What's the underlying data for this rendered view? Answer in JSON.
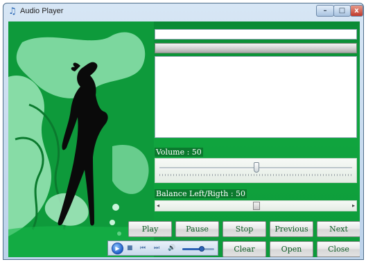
{
  "window": {
    "title": "Audio Player",
    "app_icon": "music-note-icon",
    "controls": {
      "minimize": "minimize-icon",
      "maximize": "maximize-icon",
      "close": "close-icon"
    }
  },
  "track": {
    "title": ""
  },
  "progress": {
    "value": 0
  },
  "volume": {
    "label": "Volume : 50",
    "value": 50
  },
  "balance": {
    "label": "Balance Left/Rigth : 50",
    "value": 50
  },
  "buttons": {
    "play": "Play",
    "pause": "Pause",
    "stop": "Stop",
    "previous": "Previous",
    "next": "Next",
    "clear": "Clear",
    "open": "Open",
    "close": "Close"
  },
  "mini_player": {
    "icons": [
      "play-icon",
      "stop-icon",
      "previous-icon",
      "next-icon",
      "speaker-icon"
    ],
    "volume": 0.6
  },
  "colors": {
    "accent": "#11a63f",
    "dark_green": "#0b7a2e",
    "button_text": "#0b5a22"
  }
}
